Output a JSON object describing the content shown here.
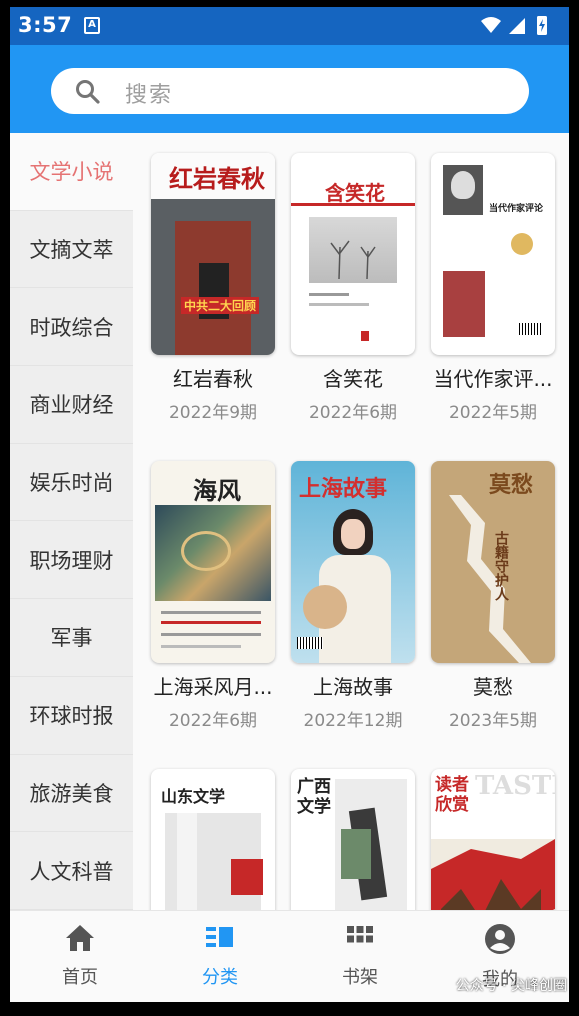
{
  "status_bar": {
    "time": "3:57",
    "notification_letter": "A"
  },
  "search": {
    "placeholder": "搜索"
  },
  "sidebar": {
    "items": [
      {
        "label": "文学小说",
        "active": true
      },
      {
        "label": "文摘文萃"
      },
      {
        "label": "时政综合"
      },
      {
        "label": "商业财经"
      },
      {
        "label": "娱乐时尚"
      },
      {
        "label": "职场理财"
      },
      {
        "label": "军事"
      },
      {
        "label": "环球时报"
      },
      {
        "label": "旅游美食"
      },
      {
        "label": "人文科普"
      }
    ]
  },
  "books": [
    {
      "title": "红岩春秋",
      "issue": "2022年9期",
      "cover_text": "红岩春秋",
      "cover_sub": "中共二大回顾"
    },
    {
      "title": "含笑花",
      "issue": "2022年6期",
      "cover_text": "含笑花"
    },
    {
      "title": "当代作家评...",
      "issue": "2022年5期",
      "cover_text": "当代作家评论"
    },
    {
      "title": "上海采风月...",
      "issue": "2022年6期",
      "cover_text": "海风"
    },
    {
      "title": "上海故事",
      "issue": "2022年12期",
      "cover_text": "上海故事"
    },
    {
      "title": "莫愁",
      "issue": "2023年5期",
      "cover_text": "莫愁",
      "cover_sub": "古籍守护人"
    },
    {
      "title": "",
      "issue": "",
      "cover_text": "山东文学"
    },
    {
      "title": "",
      "issue": "",
      "cover_text": "广西文学"
    },
    {
      "title": "",
      "issue": "",
      "cover_text": "读者欣赏",
      "cover_sub": "TASTE"
    }
  ],
  "bottom_nav": {
    "items": [
      {
        "label": "首页",
        "icon": "home-icon"
      },
      {
        "label": "分类",
        "icon": "category-icon",
        "active": true
      },
      {
        "label": "书架",
        "icon": "bookshelf-icon"
      },
      {
        "label": "我的",
        "icon": "profile-icon"
      }
    ]
  },
  "watermark": "公众号 · 尖峰创圈",
  "colors": {
    "status_bar": "#1565c0",
    "app_bar": "#2196f3",
    "accent": "#2196f3",
    "active_sidebar_text": "#e57373"
  }
}
